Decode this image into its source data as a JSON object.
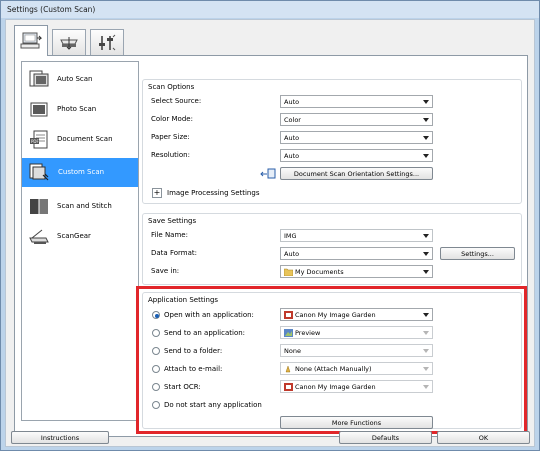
{
  "window": {
    "title": "Settings (Custom Scan)"
  },
  "tabs": [
    {
      "icon": "scan-from-computer-icon",
      "active": true
    },
    {
      "icon": "scan-from-panel-icon",
      "active": false
    },
    {
      "icon": "general-settings-icon",
      "active": false
    }
  ],
  "sidebar": {
    "items": [
      {
        "label": "Auto Scan",
        "icon": "auto-scan-icon"
      },
      {
        "label": "Photo Scan",
        "icon": "photo-scan-icon"
      },
      {
        "label": "Document Scan",
        "icon": "document-scan-icon"
      },
      {
        "label": "Custom Scan",
        "icon": "custom-scan-icon",
        "selected": true
      },
      {
        "label": "Scan and Stitch",
        "icon": "scan-and-stitch-icon"
      },
      {
        "label": "ScanGear",
        "icon": "scangear-icon"
      }
    ]
  },
  "scan_options": {
    "title": "Scan Options",
    "select_source_label": "Select Source:",
    "select_source_value": "Auto",
    "color_mode_label": "Color Mode:",
    "color_mode_value": "Color",
    "paper_size_label": "Paper Size:",
    "paper_size_value": "Auto",
    "resolution_label": "Resolution:",
    "resolution_value": "Auto",
    "orientation_button": "Document Scan Orientation Settings...",
    "image_processing_label": "Image Processing Settings",
    "expander_symbol": "+"
  },
  "save_settings": {
    "title": "Save Settings",
    "file_name_label": "File Name:",
    "file_name_value": "IMG",
    "data_format_label": "Data Format:",
    "data_format_value": "Auto",
    "settings_button": "Settings...",
    "save_in_label": "Save in:",
    "save_in_value": "My Documents"
  },
  "application_settings": {
    "title": "Application Settings",
    "options": [
      {
        "label": "Open with an application:",
        "value": "Canon My Image Garden",
        "checked": true,
        "enabled": true,
        "icon": "image-garden-icon"
      },
      {
        "label": "Send to an application:",
        "value": "Preview",
        "checked": false,
        "enabled": false,
        "icon": "preview-icon"
      },
      {
        "label": "Send to a folder:",
        "value": "None",
        "checked": false,
        "enabled": false,
        "icon": ""
      },
      {
        "label": "Attach to e-mail:",
        "value": "None (Attach Manually)",
        "checked": false,
        "enabled": false,
        "icon": "mail-app-icon"
      },
      {
        "label": "Start OCR:",
        "value": "Canon My Image Garden",
        "checked": false,
        "enabled": false,
        "icon": "image-garden-icon"
      },
      {
        "label": "Do not start any application",
        "checked": false
      }
    ],
    "more_functions_button": "More Functions"
  },
  "footer": {
    "instructions_button": "Instructions",
    "defaults_button": "Defaults",
    "ok_button": "OK"
  },
  "colors": {
    "highlight": "#e1262a",
    "selection": "#3399ff"
  }
}
